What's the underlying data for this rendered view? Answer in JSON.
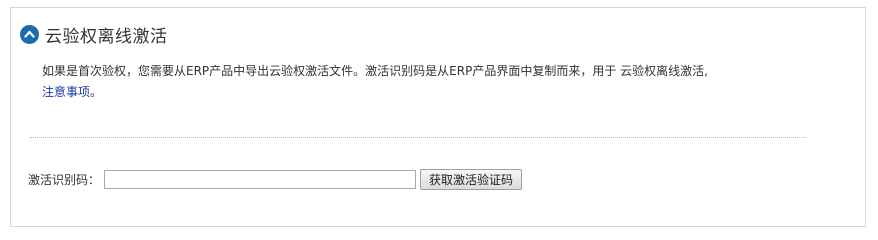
{
  "section": {
    "title": "云验权离线激活",
    "collapse_icon": "chevron-up-icon",
    "accent_color": "#1a6bb0"
  },
  "description": {
    "text": "如果是首次验权，您需要从ERP产品中导出云验权激活文件。激活识别码是从ERP产品界面中复制而来，用于 云验权离线激活,",
    "link_text": "注意事项",
    "suffix": "。"
  },
  "form": {
    "label": "激活识别码：",
    "input_value": "",
    "input_placeholder": "",
    "button_label": "获取激活验证码"
  }
}
